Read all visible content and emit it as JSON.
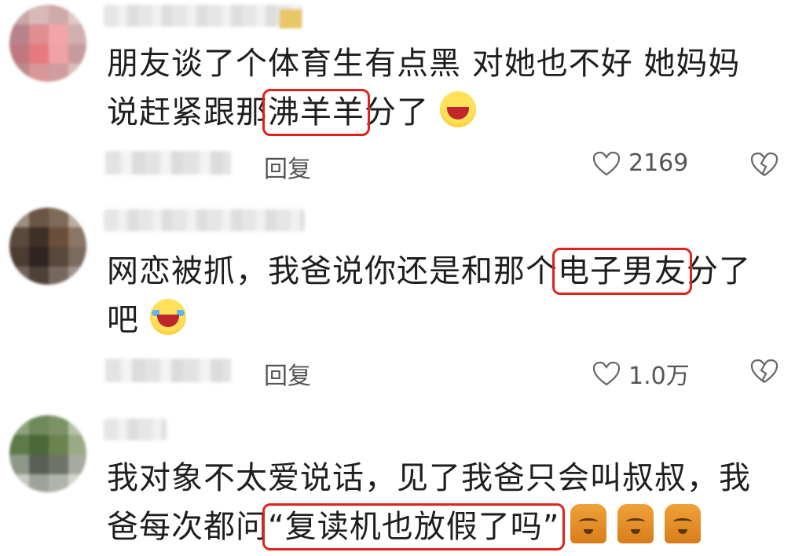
{
  "comments": [
    {
      "text_before": "朋友谈了个体育生有点黑  对她也不好  她妈妈说赶紧跟那",
      "highlight": "沸羊羊",
      "text_after": "分了",
      "reply_label": "回复",
      "like_count": "2169",
      "emoji": "laughing-emoji"
    },
    {
      "text_before": "网恋被抓，我爸说你还是和那个",
      "highlight": "电子男友",
      "text_after": "分了吧",
      "reply_label": "回复",
      "like_count": "1.0万",
      "emoji": "crying-laughing-emoji"
    },
    {
      "text_before": "我对象不太爱说话，见了我爸只会叫叔叔，我爸每次都问",
      "highlight": "“复读机也放假了吗”",
      "text_after": "",
      "emoji": "cat-emoji"
    }
  ],
  "colors": {
    "highlight_border": "#e0221f",
    "text": "#1e1e1e",
    "meta_text": "#555555"
  }
}
